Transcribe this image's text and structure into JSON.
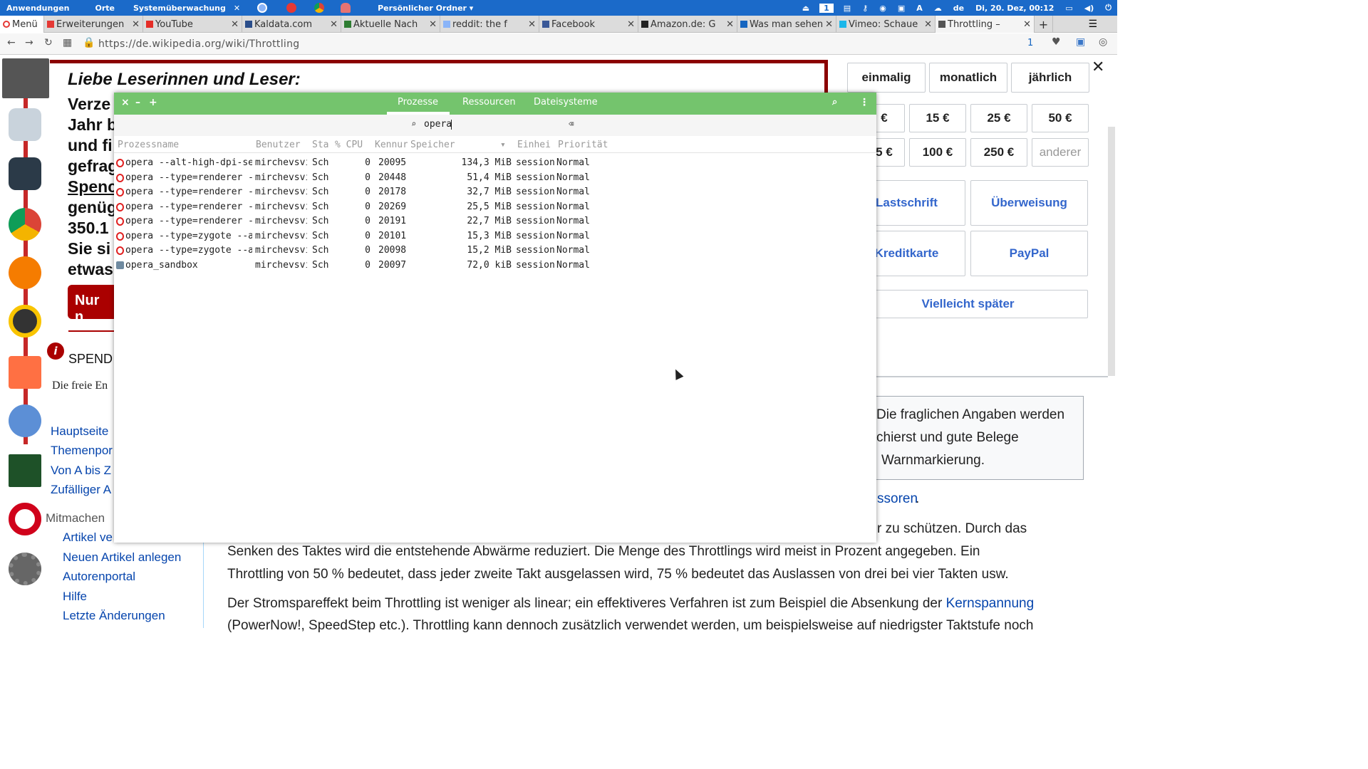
{
  "top_panel": {
    "menu_apps": "Anwendungen",
    "menu_places": "Orte",
    "menu_monitor": "Systemüberwachung",
    "folder": "Persönlicher Ordner ▾",
    "lang": "de",
    "clock": "Di, 20. Dez, 00:12"
  },
  "browser": {
    "menu_label": "Menü",
    "tabs": [
      {
        "label": "Erweiterungen",
        "color": "#e53935"
      },
      {
        "label": "YouTube",
        "color": "#e52d27"
      },
      {
        "label": "Kaldata.com",
        "color": "#2a4d8a"
      },
      {
        "label": "Aktuelle Nach",
        "color": "#2e7d32"
      },
      {
        "label": "reddit: the f",
        "color": "#8ab4f8"
      },
      {
        "label": "Facebook",
        "color": "#3b5998"
      },
      {
        "label": "Amazon.de: G",
        "color": "#222222"
      },
      {
        "label": "Was man sehen",
        "color": "#1565c0"
      },
      {
        "label": "Vimeo: Schaue",
        "color": "#1ab7ea"
      },
      {
        "label": "Throttling –",
        "color": "#555555"
      }
    ],
    "url": "https://de.wikipedia.org/wiki/Throttling",
    "badge": "1"
  },
  "wiki": {
    "banner_heading": "Liebe Leserinnen und Leser:",
    "banner_lines": [
      "Verze",
      "Jahr b",
      "und fi",
      "gefrag",
      "Spenc",
      "genüg",
      "350.1",
      "Sie si",
      "etwas"
    ],
    "banner_btn": "Nur n",
    "spend_label": "SPEND",
    "tagline": "Die freie En",
    "freq": [
      "einmalig",
      "monatlich",
      "jährlich"
    ],
    "amounts_row1": [
      "€",
      "15 €",
      "25 €",
      "50 €"
    ],
    "amounts_row2": [
      "5 €",
      "100 €",
      "250 €",
      "anderer"
    ],
    "pay": [
      "Lastschrift",
      "Überweisung",
      "Kreditkarte",
      "PayPal"
    ],
    "later": "Vielleicht später",
    "nav": [
      "Hauptseite",
      "Themenpor",
      "Von A bis Z",
      "Zufälliger A"
    ],
    "mitmachen": "Mitmachen",
    "nav2": [
      "Artikel ve",
      "Neuen Artikel anlegen",
      "Autorenportal",
      "Hilfe",
      "Letzte Änderungen"
    ],
    "box_lines": [
      "Die fraglichen Angaben werden",
      "chierst und gute Belege",
      "Warnmarkierung."
    ],
    "link_ssoren": "ssoren",
    "body_frag": "r zu schützen. Durch das",
    "para1": "Senken des Taktes wird die entstehende Abwärme reduziert. Die Menge des Throttlings wird meist in Prozent angegeben. Ein",
    "para2": "Throttling von 50 % bedeutet, dass jeder zweite Takt ausgelassen wird, 75 % bedeutet das Auslassen von drei bei vier Takten usw.",
    "para3a": "Der Stromspareffekt beim Throttling ist weniger als linear; ein effektiveres Verfahren ist zum Beispiel die Absenkung der ",
    "para3_link": "Kernspannung",
    "para4": "(PowerNow!, SpeedStep etc.). Throttling kann dennoch zusätzlich verwendet werden, um beispielsweise auf niedrigster Taktstufe noch"
  },
  "sysmon": {
    "tabs": [
      "Prozesse",
      "Ressourcen",
      "Dateisysteme"
    ],
    "search_value": "opera",
    "columns": [
      "Prozessname",
      "Benutzer",
      "Sta",
      "% CPU",
      "Kennur",
      "Speicher",
      "Einhei",
      "Priorität"
    ],
    "rows": [
      {
        "name": "opera --alt-high-dpi-set",
        "user": "mirchevsvi",
        "state": "Sch",
        "cpu": "0",
        "id": "20095",
        "mem": "134,3 MiB",
        "unit": "session",
        "prio": "Normal",
        "icon": "opera"
      },
      {
        "name": "opera --type=renderer --",
        "user": "mirchevsvi",
        "state": "Sch",
        "cpu": "0",
        "id": "20448",
        "mem": "51,4 MiB",
        "unit": "session",
        "prio": "Normal",
        "icon": "opera"
      },
      {
        "name": "opera --type=renderer --",
        "user": "mirchevsvi",
        "state": "Sch",
        "cpu": "0",
        "id": "20178",
        "mem": "32,7 MiB",
        "unit": "session",
        "prio": "Normal",
        "icon": "opera"
      },
      {
        "name": "opera --type=renderer --",
        "user": "mirchevsvi",
        "state": "Sch",
        "cpu": "0",
        "id": "20269",
        "mem": "25,5 MiB",
        "unit": "session",
        "prio": "Normal",
        "icon": "opera"
      },
      {
        "name": "opera --type=renderer --",
        "user": "mirchevsvi",
        "state": "Sch",
        "cpu": "0",
        "id": "20191",
        "mem": "22,7 MiB",
        "unit": "session",
        "prio": "Normal",
        "icon": "opera"
      },
      {
        "name": "opera --type=zygote --al",
        "user": "mirchevsvi",
        "state": "Sch",
        "cpu": "0",
        "id": "20101",
        "mem": "15,3 MiB",
        "unit": "session",
        "prio": "Normal",
        "icon": "opera"
      },
      {
        "name": "opera --type=zygote --al",
        "user": "mirchevsvi",
        "state": "Sch",
        "cpu": "0",
        "id": "20098",
        "mem": "15,2 MiB",
        "unit": "session",
        "prio": "Normal",
        "icon": "opera"
      },
      {
        "name": "opera_sandbox",
        "user": "mirchevsvi",
        "state": "Sch",
        "cpu": "0",
        "id": "20097",
        "mem": "72,0 kiB",
        "unit": "session",
        "prio": "Normal",
        "icon": "sandbox"
      }
    ]
  }
}
